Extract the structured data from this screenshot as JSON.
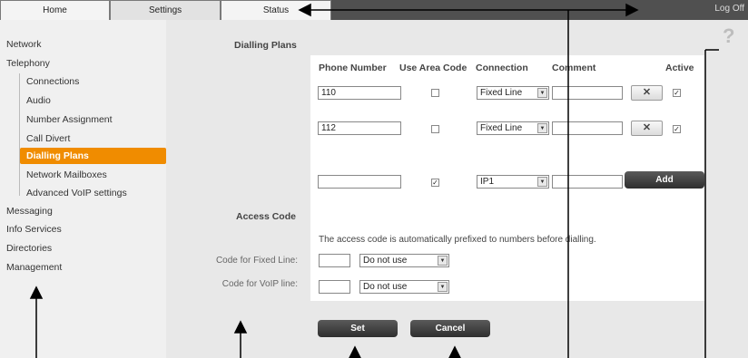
{
  "topbar": {
    "tabs": [
      {
        "label": "Home"
      },
      {
        "label": "Settings"
      },
      {
        "label": "Status"
      }
    ],
    "logoff_label": "Log Off"
  },
  "sidebar": {
    "items": [
      {
        "label": "Network"
      },
      {
        "label": "Telephony"
      },
      {
        "label": "Connections"
      },
      {
        "label": "Audio"
      },
      {
        "label": "Number Assignment"
      },
      {
        "label": "Call Divert"
      },
      {
        "label": "Dialling Plans"
      },
      {
        "label": "Network Mailboxes"
      },
      {
        "label": "Advanced VoIP settings"
      },
      {
        "label": "Messaging"
      },
      {
        "label": "Info Services"
      },
      {
        "label": "Directories"
      },
      {
        "label": "Management"
      }
    ],
    "active_color": "#f08c00"
  },
  "dialling_plans": {
    "title": "Dialling Plans",
    "columns": [
      "Phone Number",
      "Use Area Code",
      "Connection",
      "Comment",
      "Active"
    ],
    "rows": [
      {
        "number": "110",
        "use_area_code": "",
        "connection": "Fixed Line",
        "comment": "",
        "delete": "✕",
        "active": "✓"
      },
      {
        "number": "112",
        "use_area_code": "",
        "connection": "Fixed Line",
        "comment": "",
        "delete": "✕",
        "active": "✓"
      }
    ],
    "new_row": {
      "number": "",
      "use_area_code": "✓",
      "connection": "IP1",
      "comment": ""
    },
    "add_label": "Add"
  },
  "access_code": {
    "title": "Access Code",
    "note": "The access code is automatically prefixed to numbers before dialling.",
    "fixed_label": "Code for Fixed Line:",
    "fixed_value": "",
    "fixed_option": "Do not use",
    "voip_label": "Code for VoIP line:",
    "voip_value": "",
    "voip_option": "Do not use"
  },
  "actions": {
    "set_label": "Set",
    "cancel_label": "Cancel"
  },
  "help_glyph": "?",
  "select_arrow": "▼"
}
